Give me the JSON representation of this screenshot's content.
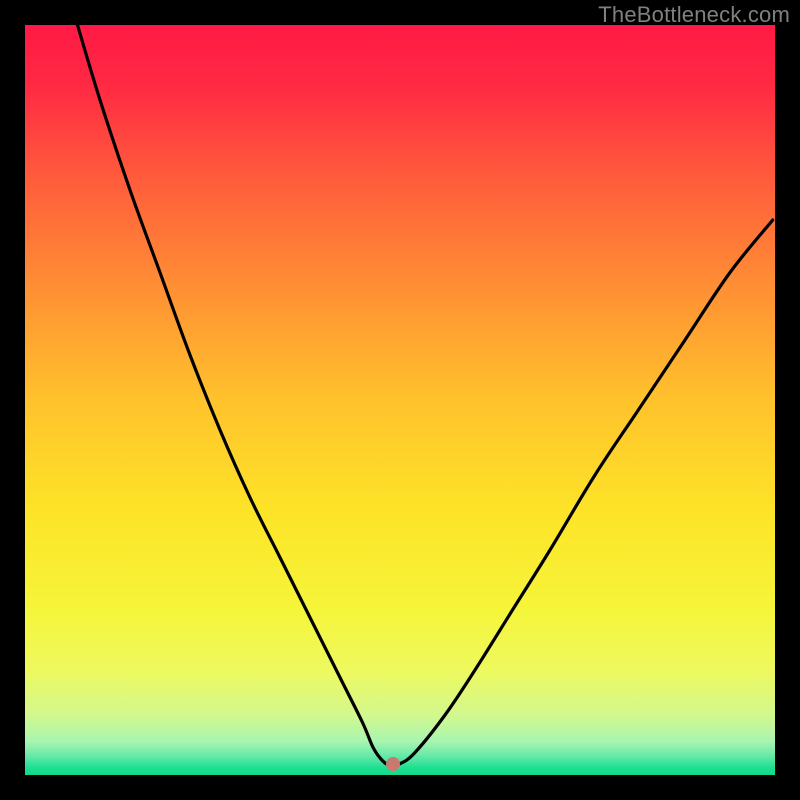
{
  "watermark": "TheBottleneck.com",
  "colors": {
    "dot": "#c97a70",
    "curve": "#000000",
    "gradient_stops": [
      {
        "offset": 0.0,
        "color": "#ff1a45"
      },
      {
        "offset": 0.08,
        "color": "#ff2943"
      },
      {
        "offset": 0.2,
        "color": "#ff5a3c"
      },
      {
        "offset": 0.35,
        "color": "#ff8f34"
      },
      {
        "offset": 0.5,
        "color": "#ffc22c"
      },
      {
        "offset": 0.65,
        "color": "#fde428"
      },
      {
        "offset": 0.78,
        "color": "#f5f53a"
      },
      {
        "offset": 0.86,
        "color": "#eef95e"
      },
      {
        "offset": 0.92,
        "color": "#d2f88e"
      },
      {
        "offset": 0.955,
        "color": "#a9f5b0"
      },
      {
        "offset": 0.975,
        "color": "#64e9a8"
      },
      {
        "offset": 0.99,
        "color": "#1fdf92"
      },
      {
        "offset": 1.0,
        "color": "#0fda88"
      }
    ]
  },
  "chart_data": {
    "type": "line",
    "title": "",
    "xlabel": "",
    "ylabel": "",
    "xlim": [
      0,
      100
    ],
    "ylim": [
      0,
      100
    ],
    "dot": {
      "x": 49,
      "y": 1.5
    },
    "series": [
      {
        "name": "curve",
        "x": [
          7,
          10,
          14,
          18,
          22,
          26,
          30,
          34,
          38,
          42,
          45,
          46.5,
          48,
          49,
          50,
          52,
          56,
          60,
          65,
          70,
          76,
          82,
          88,
          94,
          99.7
        ],
        "values": [
          100,
          90,
          78,
          67,
          56,
          46,
          37,
          29,
          21,
          13,
          7,
          3.5,
          1.6,
          1.4,
          1.5,
          3,
          8,
          14,
          22,
          30,
          40,
          49,
          58,
          67,
          74
        ]
      }
    ]
  }
}
